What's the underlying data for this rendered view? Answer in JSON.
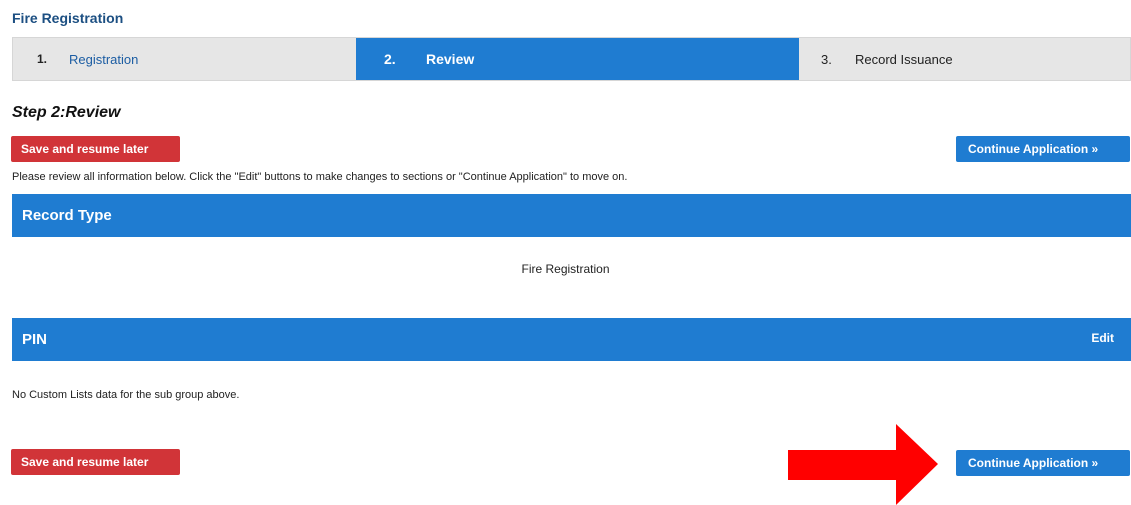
{
  "header": {
    "title": "Fire Registration"
  },
  "stepper": {
    "steps": [
      {
        "number": "1.",
        "label": "Registration"
      },
      {
        "number": "2.",
        "label": "Review"
      },
      {
        "number": "3.",
        "label": "Record Issuance"
      }
    ],
    "active_step": 2
  },
  "step_heading": "Step 2:Review",
  "buttons": {
    "save_label": "Save and resume later",
    "continue_label": "Continue Application »"
  },
  "instructions": "Please review all information below. Click the \"Edit\" buttons to make changes to sections or \"Continue Application\" to move on.",
  "sections": [
    {
      "title": "Record Type",
      "value": "Fire Registration"
    },
    {
      "title": "PIN",
      "edit_label": "Edit",
      "empty_message": "No Custom Lists data for the sub group above."
    }
  ],
  "colors": {
    "primary_blue": "#1f7cd1",
    "danger_red": "#d13438",
    "annotation_arrow": "#ff0000"
  }
}
